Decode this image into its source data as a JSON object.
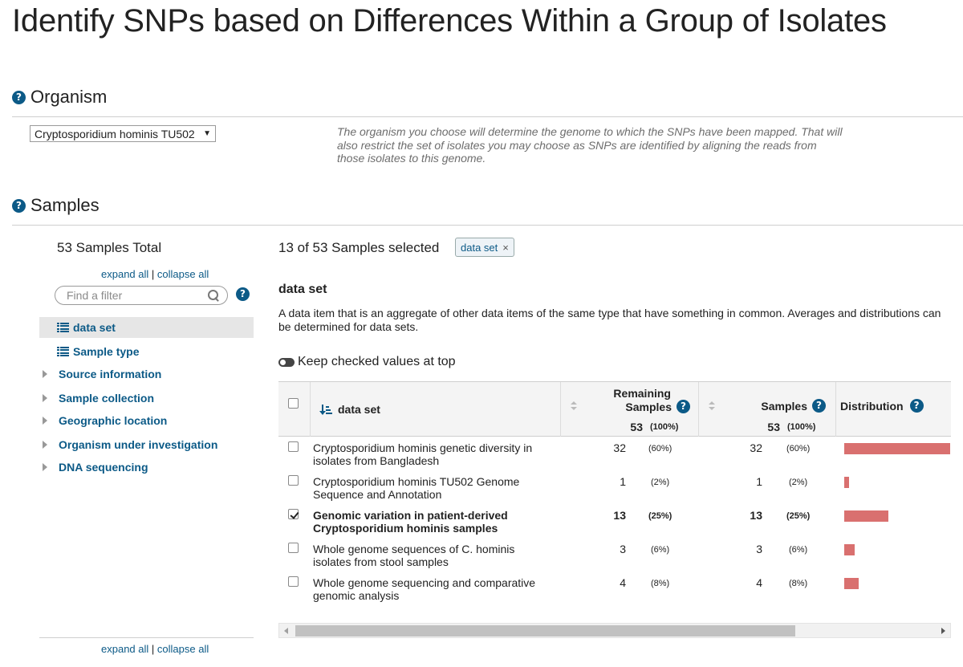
{
  "page": {
    "title": "Identify SNPs based on Differences Within a Group of Isolates"
  },
  "organism": {
    "heading": "Organism",
    "selected": "Cryptosporidium hominis TU502",
    "description": "The organism you choose will determine the genome to which the SNPs have been mapped. That will also restrict the set of isolates you may choose as SNPs are identified by aligning the reads from those isolates to this genome."
  },
  "samples": {
    "heading": "Samples",
    "total_label": "53 Samples Total",
    "expand_all": "expand all",
    "separator": "|",
    "collapse_all": "collapse all",
    "filter_placeholder": "Find a filter",
    "filters": [
      {
        "label": "data set",
        "type": "list",
        "active": true
      },
      {
        "label": "Sample type",
        "type": "list",
        "active": false
      },
      {
        "label": "Source information",
        "type": "group"
      },
      {
        "label": "Sample collection",
        "type": "group"
      },
      {
        "label": "Geographic location",
        "type": "group"
      },
      {
        "label": "Organism under investigation",
        "type": "group"
      },
      {
        "label": "DNA sequencing",
        "type": "group"
      }
    ],
    "selected_label": "13 of 53 Samples selected",
    "chip_label": "data set",
    "chip_remove": "×",
    "dataset_title": "data set",
    "dataset_desc": "A data item that is an aggregate of other data items of the same type that have something in common. Averages and distributions can be determined for data sets.",
    "keep_checked": "Keep checked values at top"
  },
  "table": {
    "col_name": "data set",
    "col_remaining_line1": "Remaining",
    "col_remaining_line2": "Samples",
    "col_samples": "Samples",
    "col_distribution": "Distribution",
    "remaining_total": "53",
    "remaining_total_pct": "(100%)",
    "samples_total": "53",
    "samples_total_pct": "(100%)",
    "rows": [
      {
        "name": "Cryptosporidium hominis genetic diversity in isolates from Bangladesh",
        "checked": false,
        "remaining": "32",
        "remaining_pct": "(60%)",
        "samples": "32",
        "samples_pct": "(60%)",
        "fraction": 0.6
      },
      {
        "name": "Cryptosporidium hominis TU502 Genome Sequence and Annotation",
        "checked": false,
        "remaining": "1",
        "remaining_pct": "(2%)",
        "samples": "1",
        "samples_pct": "(2%)",
        "fraction": 0.02
      },
      {
        "name": "Genomic variation in patient-derived Cryptosporidium hominis samples",
        "checked": true,
        "remaining": "13",
        "remaining_pct": "(25%)",
        "samples": "13",
        "samples_pct": "(25%)",
        "fraction": 0.25
      },
      {
        "name": "Whole genome sequences of C. hominis isolates from stool samples",
        "checked": false,
        "remaining": "3",
        "remaining_pct": "(6%)",
        "samples": "3",
        "samples_pct": "(6%)",
        "fraction": 0.06
      },
      {
        "name": "Whole genome sequencing and comparative genomic analysis",
        "checked": false,
        "remaining": "4",
        "remaining_pct": "(8%)",
        "samples": "4",
        "samples_pct": "(8%)",
        "fraction": 0.08
      }
    ]
  },
  "icons": {
    "help": "question-circle-icon",
    "list": "list-icon",
    "expand": "caret-right-icon",
    "search": "search-icon",
    "sort": "sort-ascending-icon"
  },
  "colors": {
    "accent": "#0c5a87",
    "bar": "#d9706f"
  }
}
